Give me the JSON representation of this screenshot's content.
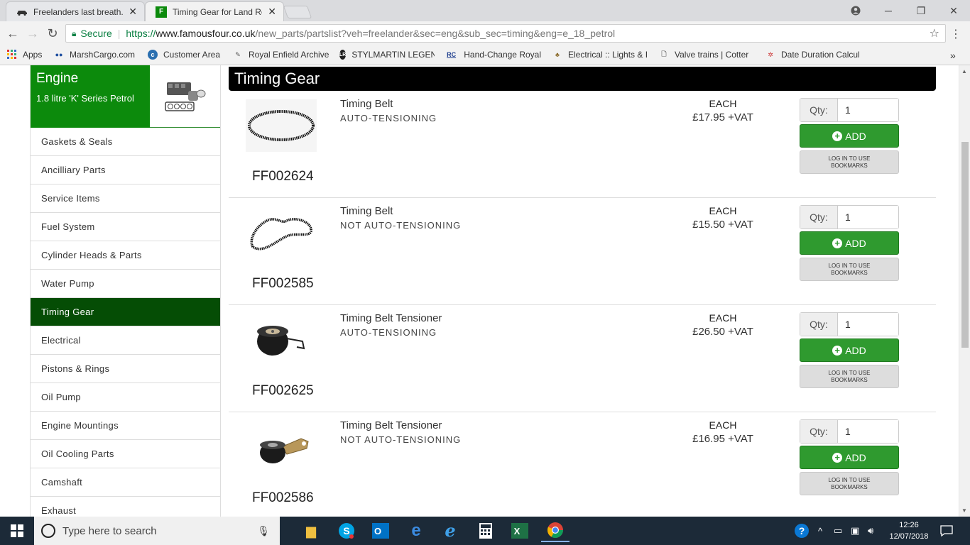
{
  "browser": {
    "tabs": [
      {
        "title": "Freelanders last breath...",
        "active": false
      },
      {
        "title": "Timing Gear for Land Rov",
        "active": true
      }
    ],
    "address": {
      "secure_label": "Secure",
      "scheme": "https://",
      "host": "www.famousfour.co.uk",
      "path": "/new_parts/partslist?veh=freelander&sec=eng&sub_sec=timing&eng=e_18_petrol"
    },
    "bookmarks": [
      {
        "label": "Apps",
        "icon": "apps-grid-icon"
      },
      {
        "label": "MarshCargo.com",
        "icon": "marshcargo-icon"
      },
      {
        "label": "Customer Area",
        "icon": "customer-area-icon"
      },
      {
        "label": "Royal Enfield Archive",
        "icon": "royal-enfield-icon"
      },
      {
        "label": "STYLMARTIN LEGEN",
        "icon": "stylmartin-icon"
      },
      {
        "label": "Hand-Change Royal",
        "icon": "rc-icon"
      },
      {
        "label": "Electrical :: Lights & I",
        "icon": "electrical-icon"
      },
      {
        "label": "Valve trains | Cotter",
        "icon": "document-icon"
      },
      {
        "label": "Date Duration Calcul",
        "icon": "date-calc-icon"
      }
    ]
  },
  "sidebar": {
    "heading": "Engine",
    "subheading": "1.8 litre 'K' Series Petrol",
    "items": [
      {
        "label": "Gaskets & Seals",
        "active": false
      },
      {
        "label": "Ancilliary Parts",
        "active": false
      },
      {
        "label": "Service Items",
        "active": false
      },
      {
        "label": "Fuel System",
        "active": false
      },
      {
        "label": "Cylinder Heads & Parts",
        "active": false
      },
      {
        "label": "Water Pump",
        "active": false
      },
      {
        "label": "Timing Gear",
        "active": true
      },
      {
        "label": "Electrical",
        "active": false
      },
      {
        "label": "Pistons & Rings",
        "active": false
      },
      {
        "label": "Oil Pump",
        "active": false
      },
      {
        "label": "Engine Mountings",
        "active": false
      },
      {
        "label": "Oil Cooling Parts",
        "active": false
      },
      {
        "label": "Camshaft",
        "active": false
      },
      {
        "label": "Exhaust",
        "active": false
      }
    ]
  },
  "content": {
    "title": "Timing Gear",
    "qty_label": "Qty:",
    "add_label": "ADD",
    "bookmark_label": "LOG IN TO USE BOOKMARKS",
    "unit_label": "EACH",
    "products": [
      {
        "code": "FF002624",
        "name": "Timing Belt",
        "desc": "AUTO-TENSIONING",
        "price": "£17.95 +VAT",
        "qty": "1",
        "image": "belt-oval"
      },
      {
        "code": "FF002585",
        "name": "Timing Belt",
        "desc": "NOT AUTO-TENSIONING",
        "price": "£15.50 +VAT",
        "qty": "1",
        "image": "belt-shaped"
      },
      {
        "code": "FF002625",
        "name": "Timing Belt Tensioner",
        "desc": "AUTO-TENSIONING",
        "price": "£26.50 +VAT",
        "qty": "1",
        "image": "tensioner-auto"
      },
      {
        "code": "FF002586",
        "name": "Timing Belt Tensioner",
        "desc": "NOT AUTO-TENSIONING",
        "price": "£16.95 +VAT",
        "qty": "1",
        "image": "tensioner-manual"
      }
    ]
  },
  "taskbar": {
    "search_placeholder": "Type here to search",
    "time": "12:26",
    "date": "12/07/2018"
  },
  "colors": {
    "brand_green": "#0c8a0c",
    "active_nav": "#054d05",
    "add_button": "#2f9a2f",
    "taskbar": "#1c2a38"
  }
}
